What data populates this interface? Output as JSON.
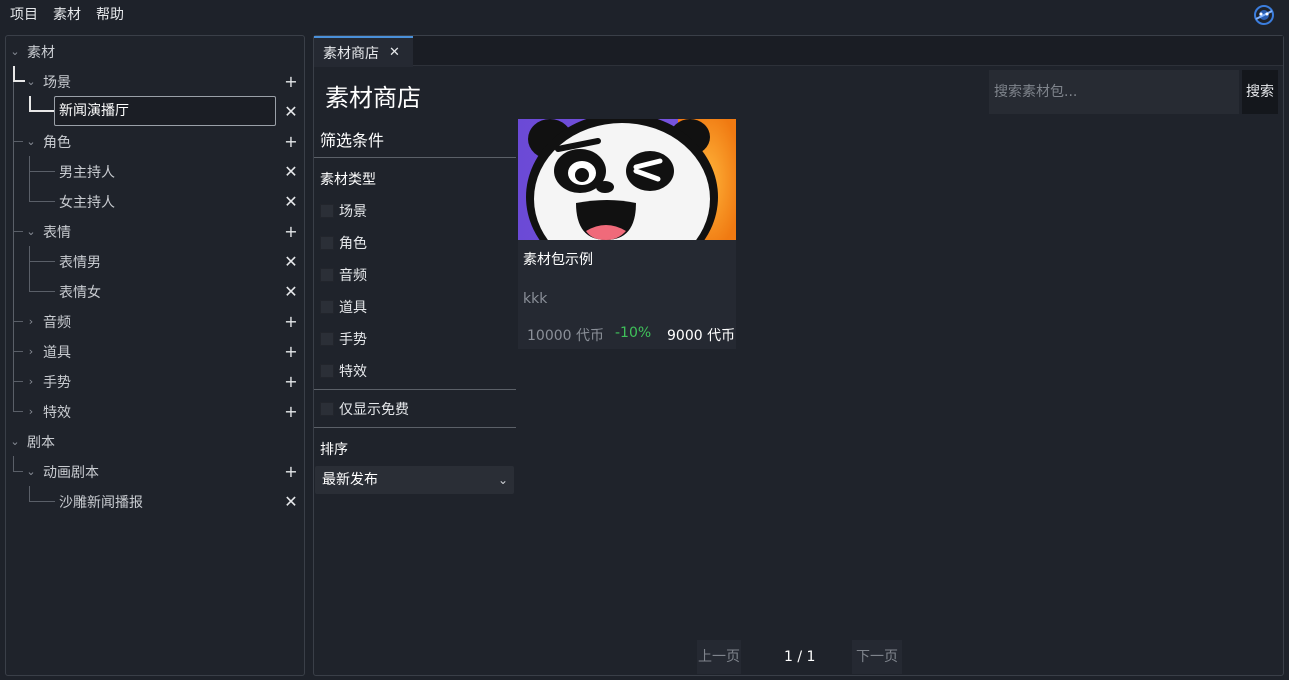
{
  "menu": [
    "项目",
    "素材",
    "帮助"
  ],
  "tree": {
    "root_assets": "素材",
    "scene": "场景",
    "scene_item_editing": "新闻演播厅",
    "role": "角色",
    "role_items": [
      "男主持人",
      "女主持人"
    ],
    "expression": "表情",
    "expression_items": [
      "表情男",
      "表情女"
    ],
    "audio": "音频",
    "prop": "道具",
    "gesture": "手势",
    "effect": "特效",
    "root_script": "剧本",
    "anim_script": "动画剧本",
    "anim_script_items": [
      "沙雕新闻播报"
    ],
    "add_icon": "plus-icon",
    "remove_icon": "close-icon"
  },
  "tab": {
    "label": "素材商店",
    "close": "✕"
  },
  "store": {
    "title": "素材商店",
    "search_placeholder": "搜索素材包...",
    "search_button": "搜索"
  },
  "filter": {
    "title": "筛选条件",
    "type_label": "素材类型",
    "types": [
      "场景",
      "角色",
      "音频",
      "道具",
      "手势",
      "特效"
    ],
    "free_only": "仅显示免费",
    "sort_label": "排序",
    "sort_value": "最新发布"
  },
  "card": {
    "name": "素材包示例",
    "desc": "kkk",
    "original_price": "10000 代币",
    "discount": "-10%",
    "price": "9000 代币",
    "discount_color": "#3fc15a"
  },
  "pagination": {
    "prev": "上一页",
    "info": "1 / 1",
    "next": "下一页"
  },
  "colors": {
    "accent": "#4a90d9",
    "background": "#1e222a"
  }
}
